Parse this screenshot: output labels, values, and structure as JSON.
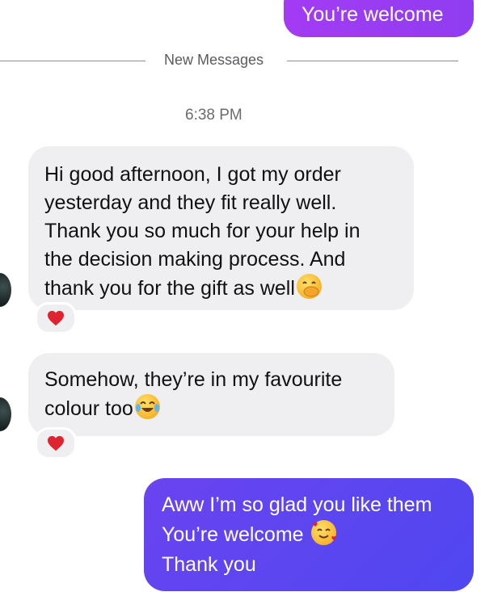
{
  "top_outgoing": {
    "text": "You’re welcome"
  },
  "divider": {
    "label": "New Messages"
  },
  "timestamp": "6:38 PM",
  "incoming": [
    {
      "lines": [
        "Hi good afternoon, I got my order",
        "yesterday and they fit really well.",
        "Thank you so much for your help in",
        "the decision making process. And",
        "thank you for the gift as well"
      ],
      "end_emoji": "hand-over-mouth-emoji",
      "reaction": "red-heart"
    },
    {
      "lines": [
        "Somehow, they’re in my favourite",
        "colour too"
      ],
      "end_emoji": "tears-of-joy-emoji",
      "reaction": "red-heart"
    }
  ],
  "bottom_outgoing": {
    "lines": [
      "Aww I’m so glad you like them",
      "You’re welcome",
      "Thank you"
    ],
    "emoji_after_line_2": "smiling-face-with-hearts-emoji"
  },
  "colors": {
    "outgoing_top": "#9a3cf2",
    "outgoing_bottom": "#5a45f0",
    "incoming_bg": "#efeff2",
    "heart": "#e0242f"
  }
}
